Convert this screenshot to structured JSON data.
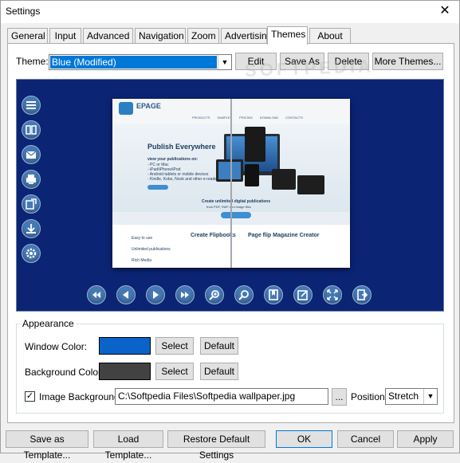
{
  "window": {
    "title": "Settings",
    "close_glyph": "✕"
  },
  "tabs": [
    "General",
    "Input",
    "Advanced",
    "Navigation",
    "Zoom",
    "Advertising",
    "Themes",
    "About Us"
  ],
  "active_tab": "Themes",
  "theme": {
    "label": "Theme:",
    "selected": "Blue (Modified)",
    "buttons": {
      "edit": "Edit",
      "save_as": "Save As",
      "delete": "Delete",
      "more": "More Themes..."
    }
  },
  "preview": {
    "background_color": "#0b2474",
    "book": {
      "brand": "EPAGE",
      "nav": [
        "PRODUCTS",
        "SAMPLES",
        "PRICING",
        "DOWNLOAD",
        "CONTACTS"
      ],
      "headline": "Publish Everywhere",
      "subhead": "view your publications on:",
      "platforms": [
        "- PC or Mac",
        "- iPad/iPhone/iPod",
        "- Android tablets or mobile devices",
        "- Kindle, Kobo, Nook and other e-readers"
      ],
      "create_line1": "Create unlimited digital publications",
      "create_line2": "from PDF, SWF and image files",
      "features": [
        "Easy to use",
        "Unlimited publications",
        "Rich Media"
      ],
      "col2_title": "Create Flipbooks",
      "col3_title": "Page flip Magazine Creator"
    },
    "side_icons": [
      "menu-icon",
      "two-page-icon",
      "email-icon",
      "print-icon",
      "share-icon",
      "download-icon",
      "settings-icon"
    ],
    "bottom_icons": [
      "first-page-icon",
      "prev-page-icon",
      "next-page-icon",
      "last-page-icon",
      "zoom-in-icon",
      "zoom-out-icon",
      "bookmark-icon",
      "edit-icon",
      "fullscreen-icon",
      "exit-icon"
    ]
  },
  "appearance": {
    "title": "Appearance",
    "window_color": {
      "label": "Window Color:",
      "value": "#0a63c9",
      "select": "Select",
      "default": "Default"
    },
    "background_color": {
      "label": "Background Color:",
      "value": "#424242",
      "select": "Select",
      "default": "Default"
    },
    "image_background": {
      "checked": true,
      "check_glyph": "✓",
      "label": "Image Background:",
      "path": "C:\\Softpedia Files\\Softpedia wallpaper.jpg",
      "browse": "...",
      "position_label": "Position:",
      "position_value": "Stretch"
    }
  },
  "footer": {
    "save_template": "Save as Template...",
    "load_template": "Load Template...",
    "restore": "Restore Default Settings",
    "ok": "OK",
    "cancel": "Cancel",
    "apply": "Apply"
  },
  "watermark": "SOFTPEDIA"
}
